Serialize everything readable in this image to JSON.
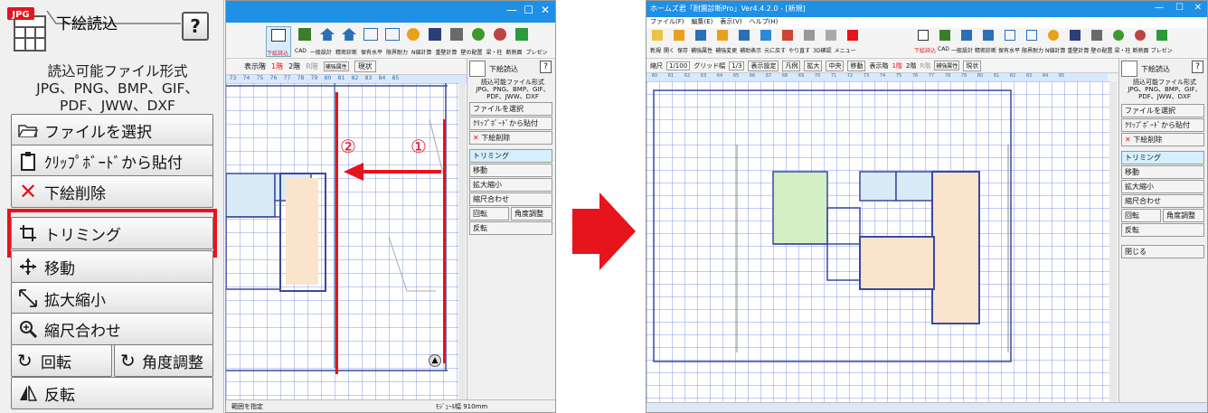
{
  "panel": {
    "icon_tag": "JPG",
    "title": "下絵読込",
    "help_label": "?",
    "info_title": "読込可能ファイル形式",
    "info_formats_1": "JPG、PNG、BMP、GIF、",
    "info_formats_2": "PDF、JWW、DXF",
    "buttons": {
      "select_file": "ファイルを選択",
      "paste": "ｸﾘｯﾌﾟﾎﾞｰﾄﾞから貼付",
      "delete": "下絵削除",
      "trim": "トリミング",
      "move": "移動",
      "scale": "拡大縮小",
      "fit_scale": "縮尺合わせ",
      "rotate": "回転",
      "angle": "角度調整",
      "flip": "反転"
    }
  },
  "left_shot": {
    "toolbar_labels": [
      "下絵読込",
      "CAD",
      "一般設計",
      "精密診断",
      "保有水平",
      "限界耐力",
      "N値計算",
      "重壁計算",
      "壁の配置",
      "梁・柱",
      "断熱面",
      "プレゼン"
    ],
    "floor_label": "表示階",
    "floor_1": "1階",
    "floor_2": "2階",
    "floor_3": "R階",
    "aux_label": "補強属性",
    "current_label": "現状",
    "ruler": [
      "73",
      "74",
      "75",
      "76",
      "77",
      "78",
      "79",
      "80",
      "81",
      "82",
      "83",
      "84",
      "85"
    ],
    "mini_title": "下絵読込",
    "mini_info_1": "読込可能ファイル形式",
    "mini_info_2": "JPG、PNG、BMP、GIF、",
    "mini_info_3": "PDF、JWW、DXF",
    "marker_1": "①",
    "marker_2": "②",
    "status_left": "範囲を指定",
    "status_right": "ﾓｼﾞｭｰﾙ幅 910mm"
  },
  "right_shot": {
    "window_title": "ホームズ君「耐震診断Pro」Ver4.4.2.0 - [新規]",
    "menu": [
      "ファイル(F)",
      "編集(E)",
      "表示(V)",
      "ヘルプ(H)"
    ],
    "toolbar_left": [
      "新規",
      "開く",
      "保存",
      "補強属性",
      "補強変更",
      "補助表示",
      "元に戻す",
      "やり直す",
      "3D確認",
      "メニュー"
    ],
    "toolbar_right": [
      "下絵読込",
      "CAD",
      "一般設計",
      "精密診断",
      "保有水平",
      "限界耐力",
      "N値計算",
      "重壁計算",
      "壁の配置",
      "梁・柱",
      "断熱面",
      "プレゼン"
    ],
    "scale_label": "縮尺",
    "scale_value": "1/100",
    "grid_label": "グリッド幅",
    "grid_value": "1/3",
    "display_settings": "表示設定",
    "legend": "凡例",
    "zoom": "拡大",
    "center": "中央",
    "move": "移動",
    "floor_label": "表示階",
    "floor_1": "1階",
    "floor_2": "2階",
    "floor_3": "R階",
    "aux_label": "補強属性",
    "current_label": "現状",
    "ruler": [
      "60",
      "61",
      "62",
      "63",
      "64",
      "65",
      "66",
      "67",
      "68",
      "69",
      "70",
      "71",
      "72",
      "73",
      "74",
      "75",
      "76",
      "77",
      "78",
      "79",
      "80",
      "81",
      "82",
      "83",
      "84",
      "85"
    ],
    "mini_title": "下絵読込",
    "mini_info_1": "読込可能ファイル形式",
    "mini_info_2": "JPG、PNG、BMP、GIF、",
    "mini_info_3": "PDF、JWW、DXF",
    "mini_buttons": [
      "ファイルを選択",
      "ｸﾘｯﾌﾟﾎﾞｰﾄﾞから貼付",
      "下絵削除",
      "トリミング",
      "移動",
      "拡大縮小",
      "縮尺合わせ",
      "回転",
      "角度調整",
      "反転",
      "閉じる"
    ]
  },
  "colors": {
    "accent_red": "#e6141b",
    "title_blue": "#1e90e6",
    "grid_blue": "#5a78d8"
  }
}
